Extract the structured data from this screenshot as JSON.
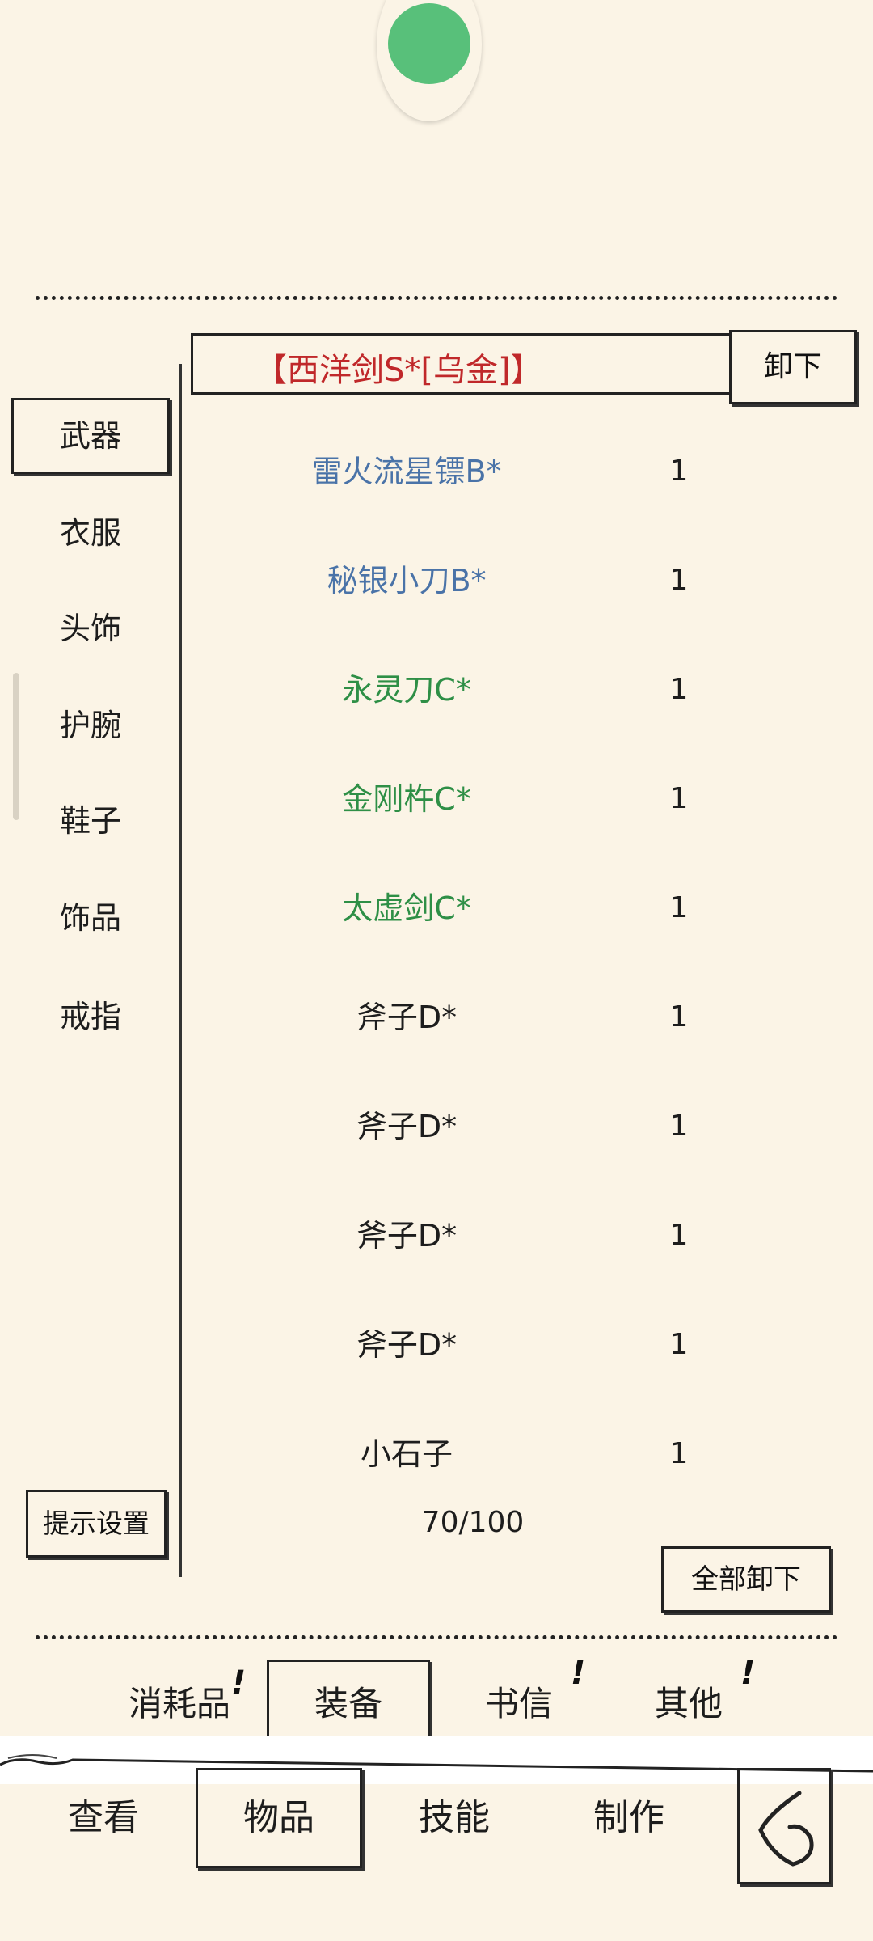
{
  "equipped": {
    "name": "【西洋剑S*[乌金]】",
    "color": "#c0282a",
    "unequip_label": "卸下"
  },
  "sidebar": {
    "items": [
      {
        "label": "武器",
        "active": true
      },
      {
        "label": "衣服"
      },
      {
        "label": "头饰"
      },
      {
        "label": "护腕"
      },
      {
        "label": "鞋子"
      },
      {
        "label": "饰品"
      },
      {
        "label": "戒指"
      }
    ],
    "hint_settings_label": "提示设置"
  },
  "items": [
    {
      "name": "雷火流星镖B*",
      "qty": "1",
      "color": "#4a73a8"
    },
    {
      "name": "秘银小刀B*",
      "qty": "1",
      "color": "#4a73a8"
    },
    {
      "name": "永灵刀C*",
      "qty": "1",
      "color": "#2e8f46"
    },
    {
      "name": "金刚杵C*",
      "qty": "1",
      "color": "#2e8f46"
    },
    {
      "name": "太虚剑C*",
      "qty": "1",
      "color": "#2e8f46"
    },
    {
      "name": "斧子D*",
      "qty": "1",
      "color": "#1d1d1d"
    },
    {
      "name": "斧子D*",
      "qty": "1",
      "color": "#1d1d1d"
    },
    {
      "name": "斧子D*",
      "qty": "1",
      "color": "#1d1d1d"
    },
    {
      "name": "斧子D*",
      "qty": "1",
      "color": "#1d1d1d"
    },
    {
      "name": "小石子",
      "qty": "1",
      "color": "#1d1d1d"
    }
  ],
  "capacity": "70/100",
  "unequip_all_label": "全部卸下",
  "category_tabs": [
    {
      "label": "消耗品",
      "alert": "!"
    },
    {
      "label": "装备",
      "active": true
    },
    {
      "label": "书信",
      "alert": "!"
    },
    {
      "label": "其他",
      "alert": "!"
    }
  ],
  "bottom_nav": [
    {
      "label": "查看"
    },
    {
      "label": "物品",
      "active": true
    },
    {
      "label": "技能"
    },
    {
      "label": "制作"
    }
  ],
  "colors": {
    "background": "#fbf4e6",
    "ink": "#222222",
    "rare_blue": "#4a73a8",
    "uncommon_green": "#2e8f46",
    "legendary_red": "#c0282a",
    "badge_green": "#58c07a"
  }
}
